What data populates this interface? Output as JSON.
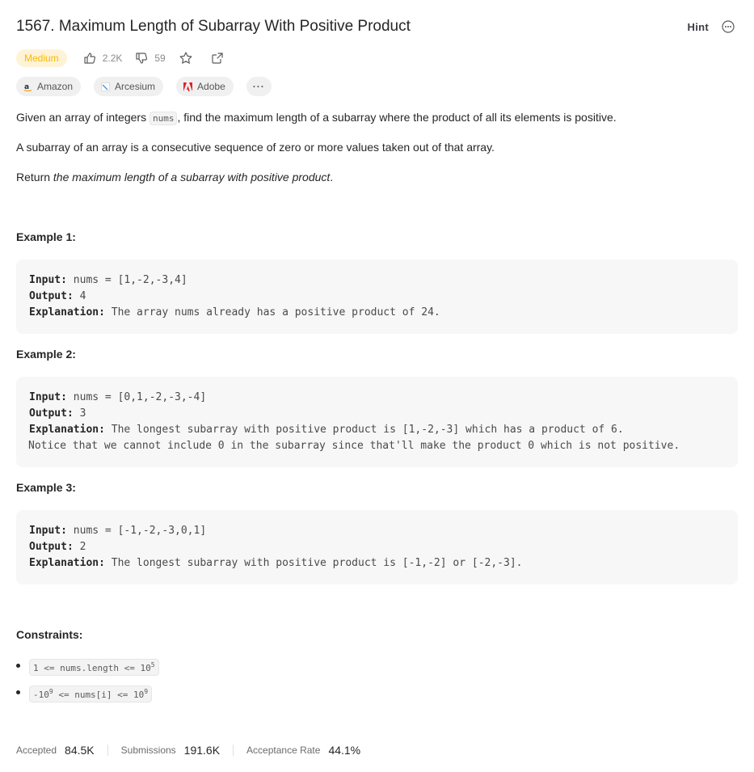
{
  "problem": {
    "title": "1567. Maximum Length of Subarray With Positive Product",
    "hint_label": "Hint",
    "difficulty": "Medium",
    "likes": "2.2K",
    "dislikes": "59"
  },
  "companies": [
    {
      "name": "Amazon",
      "color": "#ff9900"
    },
    {
      "name": "Arcesium",
      "color": "#4a8bd6"
    },
    {
      "name": "Adobe",
      "color": "#e41e26"
    }
  ],
  "more_tags_label": "···",
  "description": {
    "p1_before": "Given an array of integers ",
    "p1_code": "nums",
    "p1_after": ", find the maximum length of a subarray where the product of all its elements is positive.",
    "p2": "A subarray of an array is a consecutive sequence of zero or more values taken out of that array.",
    "p3_before": "Return ",
    "p3_em": "the maximum length of a subarray with positive product",
    "p3_after": "."
  },
  "examples": [
    {
      "heading": "Example 1:",
      "input_label": "Input:",
      "input": " nums = [1,-2,-3,4]",
      "output_label": "Output:",
      "output": " 4",
      "explanation_label": "Explanation:",
      "explanation": " The array nums already has a positive product of 24."
    },
    {
      "heading": "Example 2:",
      "input_label": "Input:",
      "input": " nums = [0,1,-2,-3,-4]",
      "output_label": "Output:",
      "output": " 3",
      "explanation_label": "Explanation:",
      "explanation": " The longest subarray with positive product is [1,-2,-3] which has a product of 6.",
      "explanation_cont": "Notice that we cannot include 0 in the subarray since that'll make the product 0 which is not positive."
    },
    {
      "heading": "Example 3:",
      "input_label": "Input:",
      "input": " nums = [-1,-2,-3,0,1]",
      "output_label": "Output:",
      "output": " 2",
      "explanation_label": "Explanation:",
      "explanation": " The longest subarray with positive product is [-1,-2] or [-2,-3]."
    }
  ],
  "constraints": {
    "heading": "Constraints:",
    "c1_text": "1 <= nums.length <= 10",
    "c1_sup": "5",
    "c2_a": "-10",
    "c2_a_sup": "9",
    "c2_b": " <= nums[i] <= 10",
    "c2_b_sup": "9"
  },
  "stats": {
    "accepted_label": "Accepted",
    "accepted": "84.5K",
    "submissions_label": "Submissions",
    "submissions": "191.6K",
    "rate_label": "Acceptance Rate",
    "rate": "44.1%"
  },
  "colors": {
    "difficulty_medium": "#ffb800",
    "difficulty_bg": "#fef3d6"
  },
  "icons": [
    "thumbs-up-icon",
    "thumbs-down-icon",
    "star-icon",
    "share-icon",
    "more-icon"
  ]
}
